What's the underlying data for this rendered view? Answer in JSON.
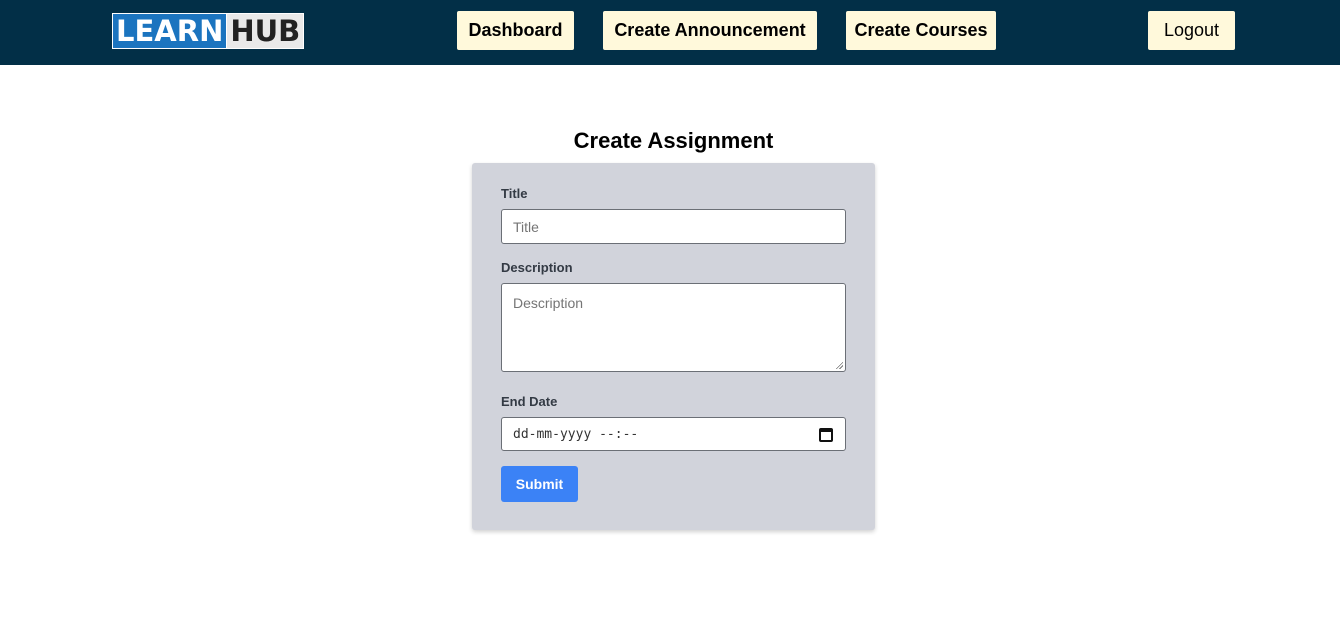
{
  "navbar": {
    "logo": {
      "part1": "LEARN",
      "part2": "HUB"
    },
    "links": {
      "dashboard": "Dashboard",
      "create_announcement": "Create Announcement",
      "create_courses": "Create Courses",
      "logout": "Logout"
    },
    "background_color": "#022f47",
    "button_color": "#fff9db"
  },
  "form": {
    "heading": "Create Assignment",
    "title_label": "Title",
    "title_placeholder": "Title",
    "description_label": "Description",
    "description_placeholder": "Description",
    "end_date_label": "End Date",
    "end_date_placeholder": "dd-mm-yyyy --:--",
    "calendar_icon": "calendar-icon",
    "submit_label": "Submit",
    "submit_color": "#3b82f6",
    "card_color": "#d1d3db"
  }
}
